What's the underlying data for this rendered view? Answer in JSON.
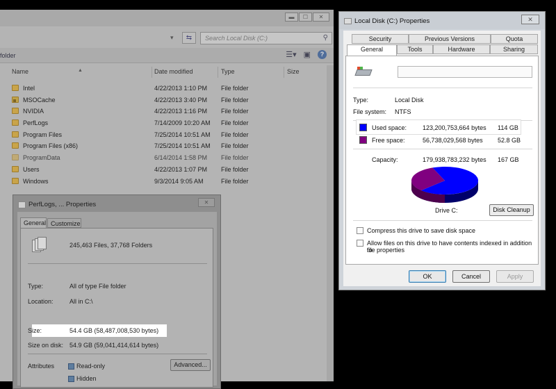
{
  "explorer": {
    "window_buttons": [
      "▬",
      "☐",
      "✕"
    ],
    "search_placeholder": "Search Local Disk (C:)",
    "toolbar_text": "folder",
    "columns": [
      "Name",
      "Date modified",
      "Type",
      "Size"
    ],
    "rows": [
      {
        "name": "Intel",
        "date": "4/22/2013 1:10 PM",
        "type": "File folder",
        "icon": "folder-icon"
      },
      {
        "name": "MSOCache",
        "date": "4/22/2013 3:40 PM",
        "type": "File folder",
        "icon": "locked-folder-icon"
      },
      {
        "name": "NVIDIA",
        "date": "4/22/2013 1:16 PM",
        "type": "File folder",
        "icon": "folder-icon"
      },
      {
        "name": "PerfLogs",
        "date": "7/14/2009 10:20 AM",
        "type": "File folder",
        "icon": "folder-icon"
      },
      {
        "name": "Program Files",
        "date": "7/25/2014 10:51 AM",
        "type": "File folder",
        "icon": "folder-icon"
      },
      {
        "name": "Program Files (x86)",
        "date": "7/25/2014 10:51 AM",
        "type": "File folder",
        "icon": "folder-icon"
      },
      {
        "name": "ProgramData",
        "date": "6/14/2014 1:58 PM",
        "type": "File folder",
        "icon": "folder-icon"
      },
      {
        "name": "Users",
        "date": "4/22/2013 1:07 PM",
        "type": "File folder",
        "icon": "folder-icon"
      },
      {
        "name": "Windows",
        "date": "9/3/2014 9:05 AM",
        "type": "File folder",
        "icon": "folder-icon"
      }
    ]
  },
  "perf_dialog": {
    "title": "PerfLogs, ... Properties",
    "tabs": [
      "General",
      "Customize"
    ],
    "summary": "245,463 Files, 37,768 Folders",
    "type_label": "Type:",
    "type_value": "All of type File folder",
    "location_label": "Location:",
    "location_value": "All in C:\\",
    "size_label": "Size:",
    "size_value": "54.4 GB (58,487,008,530 bytes)",
    "size_on_disk_label": "Size on disk:",
    "size_on_disk_value": "54.9 GB (59,041,414,614 bytes)",
    "attributes_label": "Attributes",
    "readonly_label": "Read-only",
    "hidden_label": "Hidden",
    "advanced_button": "Advanced..."
  },
  "disk_dialog": {
    "title": "Local Disk (C:) Properties",
    "tabs_row1": [
      "Security",
      "Previous Versions",
      "Quota"
    ],
    "tabs_row2": [
      "General",
      "Tools",
      "Hardware",
      "Sharing"
    ],
    "type_label": "Type:",
    "type_value": "Local Disk",
    "fs_label": "File system:",
    "fs_value": "NTFS",
    "used_label": "Used space:",
    "used_bytes": "123,200,753,664 bytes",
    "used_gb": "114 GB",
    "free_label": "Free space:",
    "free_bytes": "56,738,029,568 bytes",
    "free_gb": "52.8 GB",
    "capacity_label": "Capacity:",
    "capacity_bytes": "179,938,783,232 bytes",
    "capacity_gb": "167 GB",
    "drive_label": "Drive C:",
    "cleanup_button": "Disk Cleanup",
    "compress_label": "Compress this drive to save disk space",
    "index_label_1": "Allow files on this drive to have contents indexed in addition to",
    "index_label_2": "file properties",
    "ok_button": "OK",
    "cancel_button": "Cancel",
    "apply_button": "Apply",
    "used_fraction": 0.685,
    "colors": {
      "used": "#0000ff",
      "free": "#800080"
    }
  }
}
